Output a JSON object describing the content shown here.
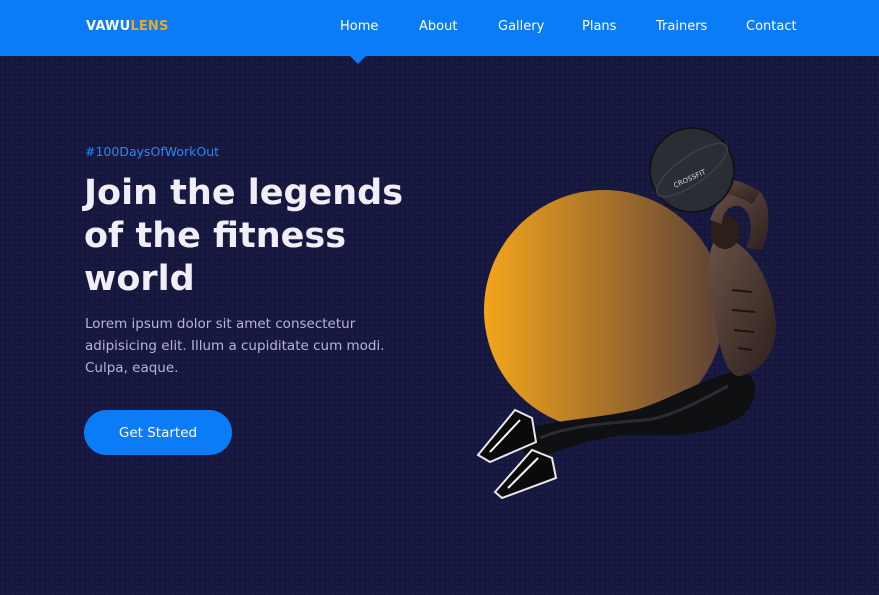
{
  "brand": {
    "primary": "VAWU",
    "accent": "LENS",
    "accent_color": "#f4a51c"
  },
  "nav": {
    "active": "Home",
    "items": [
      {
        "label": "Home"
      },
      {
        "label": "About"
      },
      {
        "label": "Gallery"
      },
      {
        "label": "Plans"
      },
      {
        "label": "Trainers"
      },
      {
        "label": "Contact"
      }
    ]
  },
  "hero": {
    "hashtag": "#100DaysOfWorkOut",
    "title_lines": [
      "Join the legends",
      "of the fitness",
      "world"
    ],
    "description": "Lorem ipsum dolor sit amet consectetur adipisicing elit. Illum a cupiditate cum modi. Culpa, eaque.",
    "cta_label": "Get Started",
    "ball_text": "CROSSFIT"
  },
  "colors": {
    "navbar": "#0a7cf8",
    "background": "#16173f",
    "hashtag": "#1f8bff",
    "circle_gradient": [
      "#f4a51c",
      "#5c4037"
    ]
  }
}
